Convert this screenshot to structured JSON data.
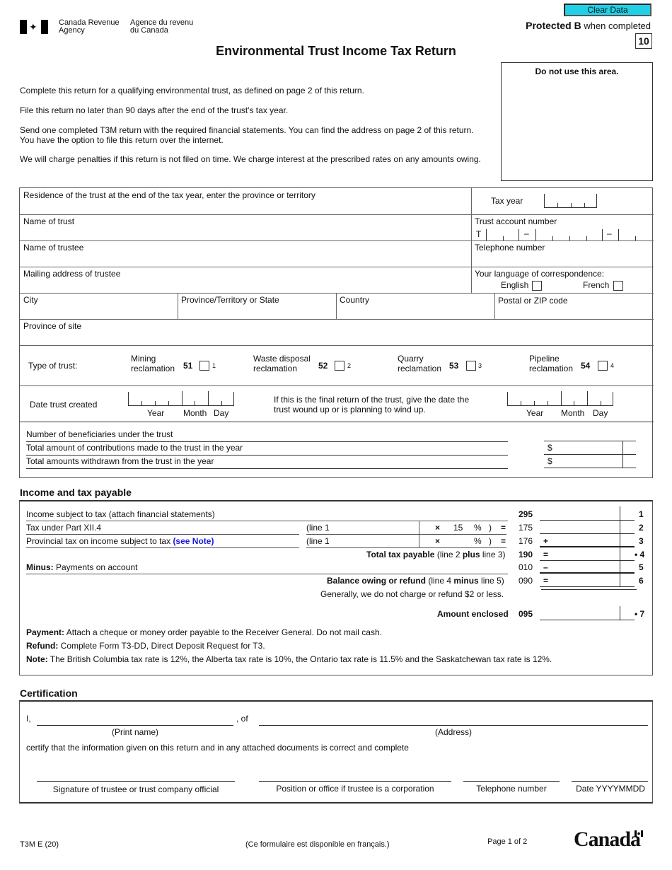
{
  "header": {
    "agency_en_line1": "Canada Revenue",
    "agency_en_line2": "Agency",
    "agency_fr_line1": "Agence du revenu",
    "agency_fr_line2": "du Canada",
    "clear_button": "Clear Data",
    "protected_bold": "Protected B",
    "protected_rest": " when completed",
    "form_box_number": "10",
    "title": "Environmental Trust Income Tax Return",
    "flag_icon": "canada-flag-icon"
  },
  "intro": {
    "p1": "Complete this return for a qualifying environmental trust, as defined on page 2 of this return.",
    "p2": "File this return no later than 90 days after the end of the trust's tax year.",
    "p3a": "Send one completed T3M return with the required financial statements. You can find the address on page 2 of this return.",
    "p3b": "You have the option to file this return over the internet.",
    "p4": "We will charge penalties if this return is not filed on time. We charge interest at the prescribed rates on any amounts owing.",
    "do_not_use": "Do not use this area."
  },
  "identification": {
    "residence": "Residence of the trust at the end of the tax year, enter the province or territory",
    "tax_year": "Tax year",
    "name_of_trust": "Name of trust",
    "trust_account_number": "Trust account number",
    "trust_account_prefix": "T",
    "dash": "–",
    "name_of_trustee": "Name of trustee",
    "telephone": "Telephone number",
    "mailing_address": "Mailing address of trustee",
    "language": "Your language of correspondence:",
    "english": "English",
    "french": "French",
    "city": "City",
    "province_state": "Province/Territory or State",
    "country": "Country",
    "postal": "Postal or ZIP code",
    "province_of_site": "Province of site"
  },
  "trust_type": {
    "label": "Type of trust:",
    "options": [
      {
        "line1": "Mining",
        "line2": "reclamation",
        "code": "51",
        "value": "1"
      },
      {
        "line1": "Waste disposal",
        "line2": "reclamation",
        "code": "52",
        "value": "2"
      },
      {
        "line1": "Quarry",
        "line2": "reclamation",
        "code": "53",
        "value": "3"
      },
      {
        "line1": "Pipeline",
        "line2": "reclamation",
        "code": "54",
        "value": "4"
      }
    ]
  },
  "dates": {
    "created_label": "Date trust created",
    "final_line1": "If this is the final return of the trust, give the date the",
    "final_line2": "trust wound up or is planning to wind up.",
    "year": "Year",
    "month": "Month",
    "day": "Day"
  },
  "beneficiaries": {
    "count_label": "Number of beneficiaries under the trust",
    "contributions_label": "Total amount of contributions made to the trust in the year",
    "withdrawn_label": "Total amounts withdrawn from the trust in the year",
    "dollar": "$"
  },
  "income": {
    "heading": "Income and tax payable",
    "rows": [
      {
        "label": "Income subject to tax (attach financial statements)",
        "code": "295",
        "line": "1"
      },
      {
        "label": "Tax under Part XII.4",
        "calc": "(line 1",
        "times": "×",
        "rate": "15",
        "pct": "%",
        "close": ")",
        "eq": "=",
        "code": "175",
        "line": "2"
      },
      {
        "label": "Provincial tax on income subject to tax ",
        "see_note": "(see Note)",
        "calc": "(line 1",
        "times": "×",
        "rate": "",
        "pct": "%",
        "close": ")",
        "eq": "=",
        "code": "176",
        "op": "+",
        "line": "3"
      },
      {
        "label_bold": "Total tax payable",
        "label_rest": " (line 2 ",
        "plus": "plus",
        "label_end": " line 3)",
        "code": "190",
        "op": "=",
        "line": "• 4"
      },
      {
        "label_bold": "Minus:",
        "label_rest": " Payments on account",
        "code": "010",
        "op": "–",
        "line": "5"
      },
      {
        "label_bold": "Balance owing or refund",
        "label_rest": " (line 4 ",
        "minus": "minus",
        "label_end": " line 5)",
        "code": "090",
        "op": "=",
        "line": "6"
      }
    ],
    "generally": "Generally, we do not charge or refund $2 or less.",
    "amount_enclosed": "Amount enclosed",
    "amount_enclosed_code": "095",
    "amount_enclosed_line": "• 7",
    "payment_bold": "Payment:",
    "payment_text": " Attach a cheque or money order payable to the Receiver General. Do not mail cash.",
    "refund_bold": "Refund:",
    "refund_text": " Complete Form T3-DD, Direct Deposit Request for T3.",
    "note_bold": "Note:",
    "note_text": " The British Columbia tax rate is 12%, the Alberta tax rate is 10%, the Ontario tax rate is 11.5% and the Saskatchewan tax rate is 12%."
  },
  "certification": {
    "heading": "Certification",
    "i": "I,",
    "of": ", of",
    "print_name": "(Print name)",
    "address": "(Address)",
    "certify": "certify that the information given on this return and in any attached documents is correct and complete",
    "signature": "Signature of trustee or trust company official",
    "position": "Position or office if trustee is a corporation",
    "telephone": "Telephone number",
    "date": "Date YYYYMMDD"
  },
  "footer": {
    "form_id": "T3M E (20)",
    "french_note": "(Ce formulaire est disponible en français.)",
    "page": "Page 1 of 2",
    "wordmark": "Canada"
  }
}
